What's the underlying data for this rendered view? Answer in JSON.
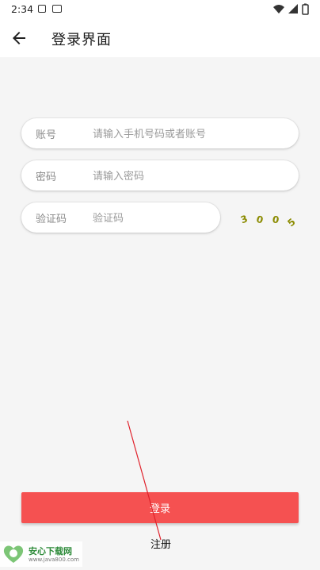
{
  "status_bar": {
    "time": "2:34"
  },
  "app_bar": {
    "title": "登录界面"
  },
  "form": {
    "account": {
      "label": "账号",
      "placeholder": "请输入手机号码或者账号"
    },
    "password": {
      "label": "密码",
      "placeholder": "请输入密码"
    },
    "captcha": {
      "label": "验证码",
      "placeholder": "验证码",
      "image_text": "3005"
    }
  },
  "actions": {
    "login_label": "登录",
    "register_label": "注册"
  },
  "watermark": {
    "text": "安心下载网",
    "url": "www.java800.com"
  },
  "colors": {
    "accent": "#f55151",
    "background": "#f5f5f5",
    "captcha_text": "#8b8b00",
    "annotation": "#e0202a"
  }
}
